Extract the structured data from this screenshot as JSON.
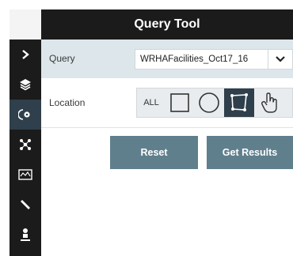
{
  "header": {
    "title": "Query Tool"
  },
  "query": {
    "label": "Query",
    "selected": "WRHAFacilities_Oct17_16"
  },
  "location": {
    "label": "Location",
    "all_label": "ALL"
  },
  "buttons": {
    "reset": "Reset",
    "get_results": "Get Results"
  },
  "sidebar": {
    "items": [
      {
        "icon": "chevron-right-icon"
      },
      {
        "icon": "layers-icon"
      },
      {
        "icon": "query-tool-icon",
        "active": true
      },
      {
        "icon": "network-icon"
      },
      {
        "icon": "map-icon"
      },
      {
        "icon": "ruler-icon"
      },
      {
        "icon": "person-icon"
      }
    ]
  },
  "colors": {
    "rail": "#1b1b1b",
    "active": "#2f3f4b",
    "query_row": "#dde6ea",
    "button": "#5f7f8d"
  }
}
